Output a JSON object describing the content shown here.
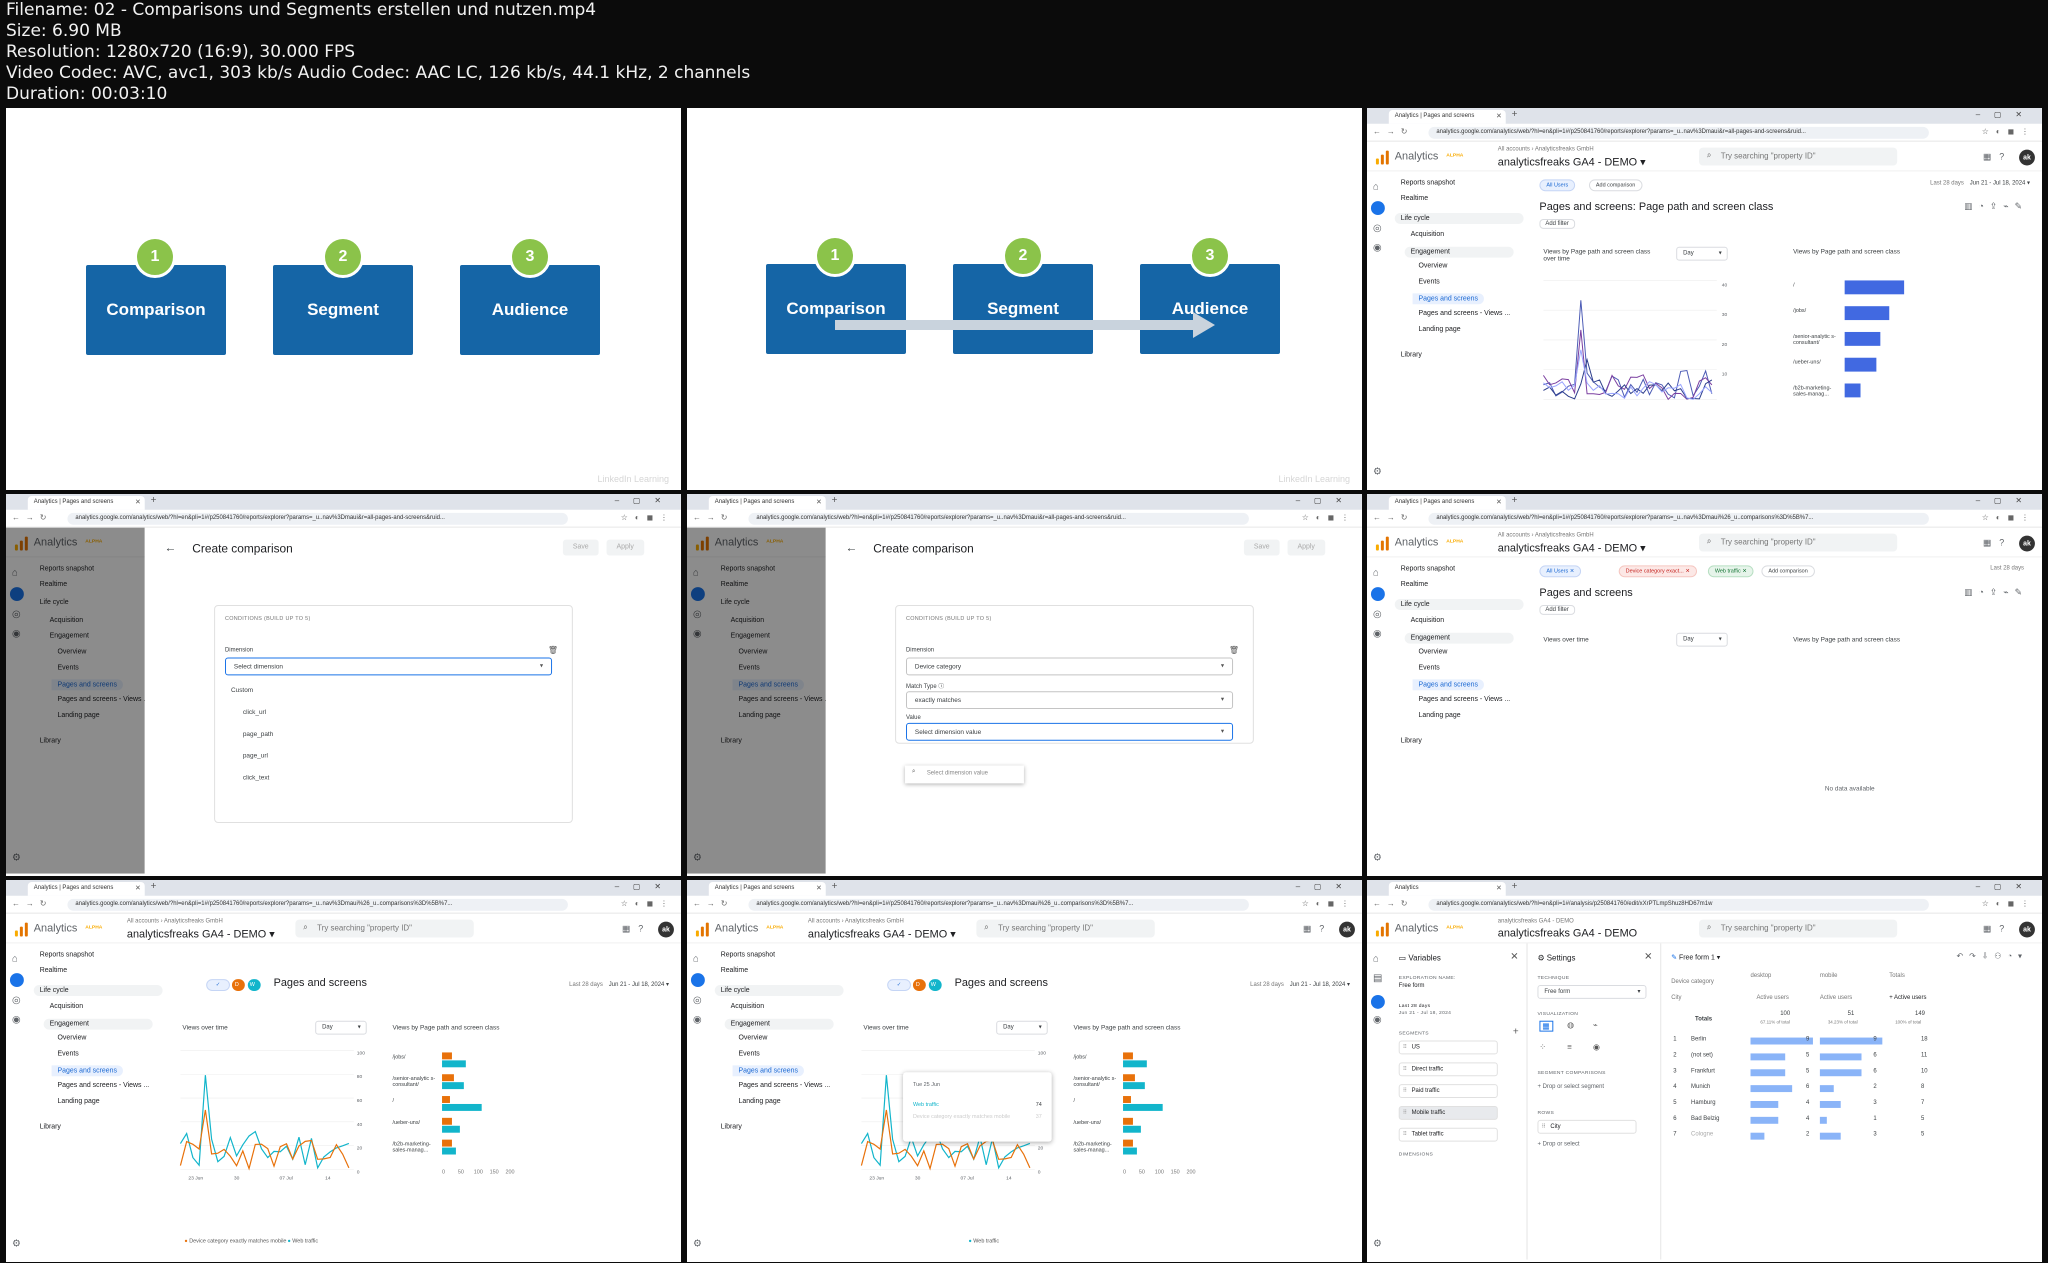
{
  "file_info": {
    "filename": "Filename: 02 - Comparisons und Segments erstellen und nutzen.mp4",
    "size": "Size: 6.90 MB",
    "resolution": "Resolution: 1280x720 (16:9), 30.000 FPS",
    "video": "Video Codec: AVC, avc1, 303 kb/s Audio Codec: AAC LC, 126 kb/s, 44.1 kHz, 2 channels",
    "duration": "Duration: 00:03:10"
  },
  "slide": {
    "items": [
      {
        "num": "1",
        "label": "Comparison"
      },
      {
        "num": "2",
        "label": "Segment"
      },
      {
        "num": "3",
        "label": "Audience"
      }
    ],
    "watermark": "LinkedIn Learning"
  },
  "browser": {
    "tab_title": "Analytics | Pages and screens",
    "tab_title_explore": "Analytics",
    "url_reports": "analytics.google.com/analytics/web/?hl=en&pli=1#/p250841760/reports/explorer?params=_u..nav%3Dmaui&r=all-pages-and-screens&ruid...",
    "url_compare": "analytics.google.com/analytics/web/?hl=en&pli=1#/p250841760/reports/explorer?params=_u..nav%3Dmaui%26_u..comparisons%3D%5B%7...",
    "url_explore": "analytics.google.com/analytics/web/?hl=en&pli=1#/analysis/p250841760/edit/xXrPTLmpShuz8HD67m1w"
  },
  "ga": {
    "app_name": "Analytics",
    "alpha": "ALPHA",
    "crumb": "All accounts › Analyticsfreaks GmbH",
    "crumb_explore": "analyticsfreaks GA4 - DEMO",
    "property": "analyticsfreaks GA4 - DEMO ▾",
    "property_plain": "analyticsfreaks GA4 - DEMO",
    "search_placeholder": "Try searching \"property ID\"",
    "avatar": "ak",
    "date_label": "Last 28 days",
    "date_range": "Jun 21 - Jul 18, 2024 ▾"
  },
  "nav": {
    "reports_snapshot": "Reports snapshot",
    "realtime": "Realtime",
    "life_cycle": "Life cycle",
    "acquisition": "Acquisition",
    "engagement": "Engagement",
    "overview": "Overview",
    "events": "Events",
    "pages_and_screens": "Pages and screens",
    "pages_views": "Pages and screens - Views ...",
    "landing_page": "Landing page",
    "library": "Library"
  },
  "report": {
    "all_users": "All Users",
    "add_comparison": "Add comparison",
    "title_path": "Pages and screens: Page path and screen class",
    "title": "Pages and screens",
    "add_filter": "Add filter",
    "card_views_path": "Views by Page path and screen class over time",
    "card_views": "Views over time",
    "day": "Day",
    "card_bar": "Views by Page path and screen class",
    "device_chip": "Device category exact...",
    "web_chip": "Web traffic",
    "no_data": "No data available",
    "chip_d": "D",
    "chip_w": "W",
    "legend_mobile": "Device category exactly matches mobile",
    "legend_web": "Web traffic",
    "legend_right": "Device category exactly matches mobile"
  },
  "compare_dialog": {
    "title": "Create comparison",
    "save": "Save",
    "apply": "Apply",
    "conditions": "CONDITIONS (BUILD UP TO 5)",
    "dimension_label": "Dimension",
    "select_dimension": "Select dimension",
    "menu_items": [
      "Custom",
      "click_url",
      "page_path",
      "page_url",
      "click_text"
    ],
    "device_category": "Device category",
    "match_type_label": "Match Type ⓘ",
    "exactly_matches": "exactly matches",
    "value_label": "Value",
    "select_value": "Select dimension value",
    "select_value_search": "Select dimension value"
  },
  "tooltip": {
    "date": "Tue 25 Jun",
    "series": "Web traffic",
    "value": "74",
    "series2": "Device category exactly matches mobile",
    "value2": "37"
  },
  "explore": {
    "variables": "Variables",
    "settings": "Settings",
    "expl_name_label": "EXPLORATION NAME:",
    "expl_name": "Free form",
    "date_label": "Last 28 days",
    "date": "Jun 21 - Jul 18, 2024",
    "segments_label": "SEGMENTS",
    "segments": [
      "US",
      "Direct traffic",
      "Paid traffic",
      "Mobile traffic",
      "Tablet traffic"
    ],
    "dimensions_label": "DIMENSIONS",
    "technique_label": "TECHNIQUE",
    "technique": "Free form",
    "visualization_label": "VISUALIZATION",
    "segment_comparisons": "SEGMENT COMPARISONS",
    "drop_segment": "Drop or select segment",
    "rows_label": "ROWS",
    "row_city": "City",
    "drop_select": "Drop or select",
    "tab_name": "Free form 1",
    "device_category": "Device category",
    "city": "City",
    "cols": [
      "desktop",
      "mobile",
      "Totals"
    ],
    "metric": "Active users",
    "metric_total": "+ Active users",
    "totals_label": "Totals",
    "totals": [
      "100",
      "51",
      "149"
    ],
    "totals_sub": [
      "67.11% of total",
      "34.23% of total",
      "100% of total"
    ],
    "rows": [
      {
        "n": "1",
        "city": "Berlin",
        "d": "9",
        "m": "9",
        "t": "18"
      },
      {
        "n": "2",
        "city": "(not set)",
        "d": "5",
        "m": "6",
        "t": "11"
      },
      {
        "n": "3",
        "city": "Frankfurt",
        "d": "5",
        "m": "6",
        "t": "10"
      },
      {
        "n": "4",
        "city": "Munich",
        "d": "6",
        "m": "2",
        "t": "8"
      },
      {
        "n": "5",
        "city": "Hamburg",
        "d": "4",
        "m": "3",
        "t": "7"
      },
      {
        "n": "6",
        "city": "Bad Belzig",
        "d": "4",
        "m": "1",
        "t": "5"
      },
      {
        "n": "7",
        "city": "Cologne",
        "d": "2",
        "m": "3",
        "t": "5"
      }
    ]
  },
  "bars": {
    "labels_a": [
      "/",
      "/jobs/",
      "/senior-analytic s-consultant/",
      "/ueber-uns/",
      "/b2b-marketing- sales-manag..."
    ],
    "labels_b": [
      "/jobs/",
      "/senior-analytic s-consultant/",
      "/",
      "/ueber-uns/",
      "/b2b-marketing- sales-manag..."
    ],
    "x_ticks": [
      "0",
      "50",
      "100",
      "150",
      "200"
    ],
    "y_ticks": [
      "100",
      "80",
      "60",
      "40",
      "20",
      "0"
    ],
    "y_ticks_small": [
      "40",
      "30",
      "20",
      "10"
    ],
    "x_dates": [
      "23 Jun",
      "30",
      "07 Jul",
      "14"
    ]
  },
  "colors": {
    "slide_blue": "#1565a6",
    "slide_green": "#8bc34a",
    "ga_blue": "#1a73e8",
    "series_orange": "#e8710a",
    "series_teal": "#12b5cb",
    "bar_blue": "#4169e1"
  }
}
